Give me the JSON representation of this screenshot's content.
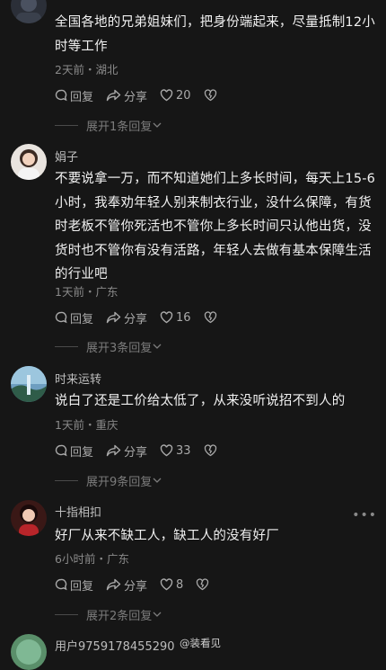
{
  "comments": [
    {
      "username": "",
      "text": "全国各地的兄弟姐妹们，把身份端起来，尽量抵制12小时等工作",
      "meta": "2天前・湖北",
      "reply": "回复",
      "share": "分享",
      "likes": "20",
      "expand": "展开1条回复"
    },
    {
      "username": "娟子",
      "text": "不要说拿一万，而不知道她们上多长时间，每天上15-6小时，我奉劝年轻人别来制衣行业，没什么保障，有货时老板不管你死活也不管你上多长时间只认他出货，没货时也不管你有没有活路，年轻人去做有基本保障生活的行业吧",
      "meta": "1天前・广东",
      "reply": "回复",
      "share": "分享",
      "likes": "16",
      "expand": "展开3条回复"
    },
    {
      "username": "时来运转",
      "text": "说白了还是工价给太低了，从来没听说招不到人的",
      "meta": "1天前・重庆",
      "reply": "回复",
      "share": "分享",
      "likes": "33",
      "expand": "展开9条回复"
    },
    {
      "username": "十指相扣",
      "text": "好厂从来不缺工人，缺工人的没有好厂",
      "meta": "6小时前・广东",
      "reply": "回复",
      "share": "分享",
      "likes": "8",
      "expand": "展开2条回复"
    },
    {
      "username": "用户9759178455290"
    }
  ],
  "more_menu": "•••",
  "watermark": "@装看见"
}
